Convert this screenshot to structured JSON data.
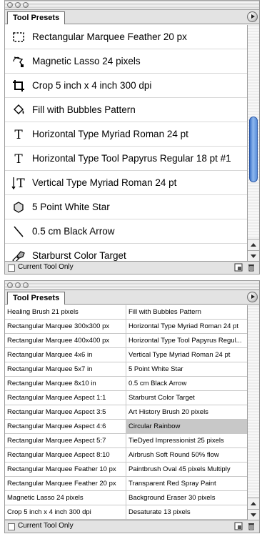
{
  "palette_top": {
    "tab_label": "Tool Presets",
    "items": [
      {
        "icon": "rect-marquee-icon",
        "label": "Rectangular Marquee Feather 20 px"
      },
      {
        "icon": "magnetic-lasso-icon",
        "label": "Magnetic Lasso 24 pixels"
      },
      {
        "icon": "crop-icon",
        "label": "Crop 5 inch x 4 inch 300 dpi"
      },
      {
        "icon": "paint-bucket-icon",
        "label": "Fill with Bubbles Pattern"
      },
      {
        "icon": "type-icon",
        "label": "Horizontal Type Myriad Roman 24 pt"
      },
      {
        "icon": "type-icon",
        "label": "Horizontal Type Tool Papyrus Regular 18 pt #1"
      },
      {
        "icon": "vertical-type-icon",
        "label": "Vertical Type Myriad Roman 24 pt"
      },
      {
        "icon": "polygon-icon",
        "label": "5 Point White Star"
      },
      {
        "icon": "line-icon",
        "label": "0.5 cm Black Arrow"
      },
      {
        "icon": "color-sampler-icon",
        "label": "Starburst Color Target"
      }
    ],
    "checkbox_label": "Current Tool Only",
    "current_tool_only_checked": false
  },
  "palette_bottom": {
    "tab_label": "Tool Presets",
    "rows": [
      [
        "Healing Brush 21 pixels",
        "Fill with Bubbles Pattern"
      ],
      [
        "Rectangular Marquee 300x300 px",
        "Horizontal Type Myriad Roman 24 pt"
      ],
      [
        "Rectangular Marquee 400x400 px",
        "Horizontal Type Tool Papyrus Regul..."
      ],
      [
        "Rectangular Marquee 4x6 in",
        "Vertical Type Myriad Roman 24 pt"
      ],
      [
        "Rectangular Marquee 5x7 in",
        "5 Point White Star"
      ],
      [
        "Rectangular Marquee 8x10 in",
        "0.5 cm Black Arrow"
      ],
      [
        "Rectangular Marquee Aspect 1:1",
        "Starburst Color Target"
      ],
      [
        "Rectangular Marquee Aspect 3:5",
        "Art History Brush 20 pixels"
      ],
      [
        "Rectangular Marquee Aspect 4:6",
        "Circular Rainbow"
      ],
      [
        "Rectangular Marquee Aspect 5:7",
        "TieDyed Impressionist 25 pixels"
      ],
      [
        "Rectangular Marquee Aspect 8:10",
        "Airbrush Soft Round 50% flow"
      ],
      [
        "Rectangular Marquee Feather 10 px",
        "Paintbrush Oval 45 pixels Multiply"
      ],
      [
        "Rectangular Marquee Feather 20 px",
        "Transparent Red Spray Paint"
      ],
      [
        "Magnetic Lasso 24 pixels",
        "Background Eraser 30 pixels"
      ],
      [
        "Crop 5 inch x 4 inch 300 dpi",
        "Desaturate 13 pixels"
      ]
    ],
    "selected_item": "Circular Rainbow",
    "checkbox_label": "Current Tool Only",
    "current_tool_only_checked": false
  }
}
